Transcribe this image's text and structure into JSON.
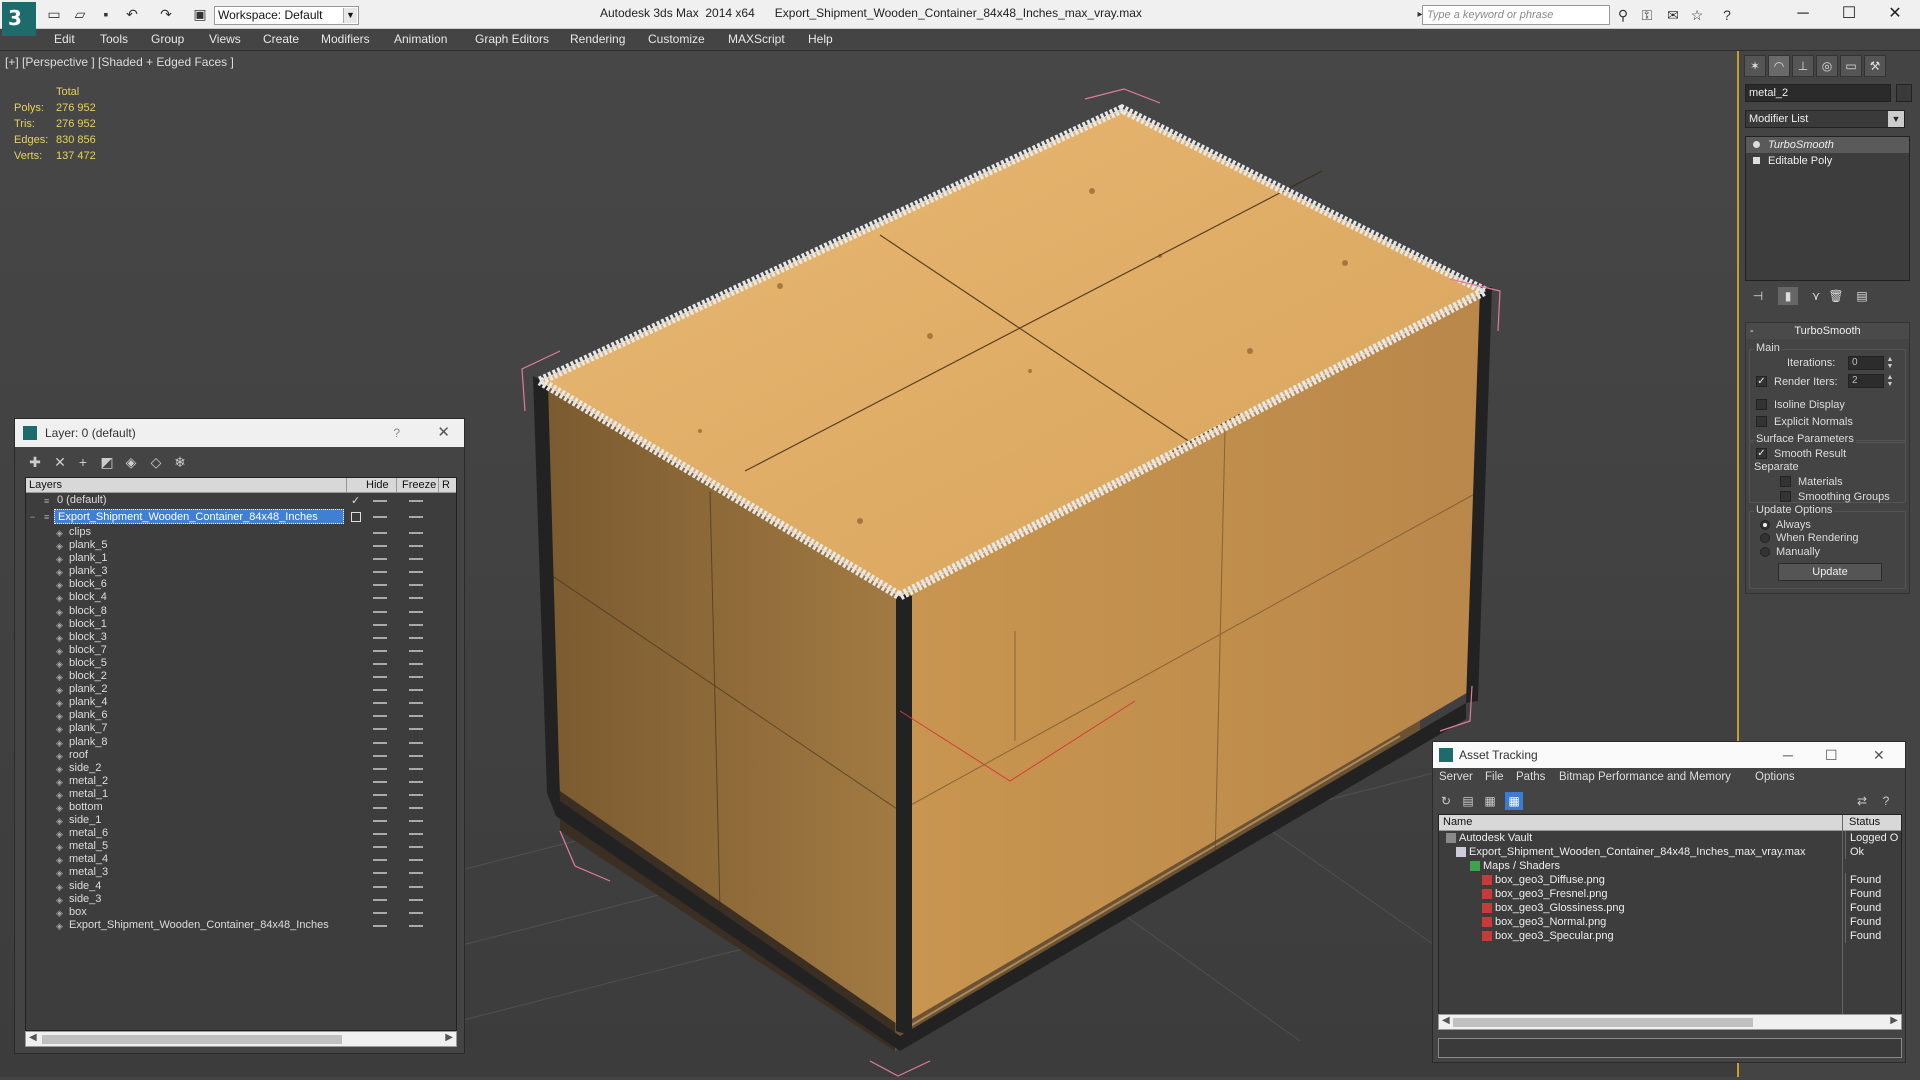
{
  "window": {
    "app_title": "Autodesk 3ds Max  2014 x64",
    "file_title": "Export_Shipment_Wooden_Container_84x48_Inches_max_vray.max",
    "workspace": "Workspace: Default",
    "search_placeholder": "Type a keyword or phrase"
  },
  "menu": [
    "Edit",
    "Tools",
    "Group",
    "Views",
    "Create",
    "Modifiers",
    "Animation",
    "Graph Editors",
    "Rendering",
    "Customize",
    "MAXScript",
    "Help"
  ],
  "viewport": {
    "label": "[+] [Perspective ] [Shaded + Edged Faces ]",
    "stats": {
      "header": "Total",
      "rows": [
        {
          "k": "Polys:",
          "v": "276 952"
        },
        {
          "k": "Tris:",
          "v": "276 952"
        },
        {
          "k": "Edges:",
          "v": "830 856"
        },
        {
          "k": "Verts:",
          "v": "137 472"
        }
      ]
    }
  },
  "command_panel": {
    "object_name": "metal_2",
    "modifier_list": "Modifier List",
    "stack": [
      "TurboSmooth",
      "Editable Poly"
    ],
    "rollout_title": "TurboSmooth",
    "main_label": "Main",
    "iterations_label": "Iterations:",
    "iterations_value": "0",
    "render_iters_label": "Render Iters:",
    "render_iters_value": "2",
    "isoline": "Isoline Display",
    "explicit_normals": "Explicit Normals",
    "surface_params": "Surface Parameters",
    "smooth_result": "Smooth Result",
    "separate": "Separate",
    "materials": "Materials",
    "smoothing_groups": "Smoothing Groups",
    "update_options": "Update Options",
    "always": "Always",
    "when_rendering": "When Rendering",
    "manually": "Manually",
    "update_button": "Update"
  },
  "layer_panel": {
    "title": "Layer: 0 (default)",
    "help": "?",
    "columns": {
      "layers": "Layers",
      "hide": "Hide",
      "freeze": "Freeze",
      "r": "R"
    },
    "default_layer": "0 (default)",
    "selected_layer": "Export_Shipment_Wooden_Container_84x48_Inches",
    "objects": [
      "clips",
      "plank_5",
      "plank_1",
      "plank_3",
      "block_6",
      "block_4",
      "block_8",
      "block_1",
      "block_3",
      "block_7",
      "block_5",
      "block_2",
      "plank_2",
      "plank_4",
      "plank_6",
      "plank_7",
      "plank_8",
      "roof",
      "side_2",
      "metal_2",
      "metal_1",
      "bottom",
      "side_1",
      "metal_6",
      "metal_5",
      "metal_4",
      "metal_3",
      "side_4",
      "side_3",
      "box",
      "Export_Shipment_Wooden_Container_84x48_Inches"
    ]
  },
  "asset_tracking": {
    "title": "Asset Tracking",
    "menu": [
      "Server",
      "File",
      "Paths",
      "Bitmap Performance and Memory",
      "Options"
    ],
    "columns": {
      "name": "Name",
      "status": "Status"
    },
    "rows": [
      {
        "name": "Autodesk Vault",
        "status": "Logged O"
      },
      {
        "name": "Export_Shipment_Wooden_Container_84x48_Inches_max_vray.max",
        "status": "Ok"
      },
      {
        "name": "Maps / Shaders",
        "status": ""
      },
      {
        "name": "box_geo3_Diffuse.png",
        "status": "Found"
      },
      {
        "name": "box_geo3_Fresnel.png",
        "status": "Found"
      },
      {
        "name": "box_geo3_Glossiness.png",
        "status": "Found"
      },
      {
        "name": "box_geo3_Normal.png",
        "status": "Found"
      },
      {
        "name": "box_geo3_Specular.png",
        "status": "Found"
      }
    ]
  },
  "colors": {
    "accent_selection": "#3f7fd5",
    "stats_text": "#e6d25a",
    "viewport_border": "#c8a028",
    "wood": "#d9a55a"
  }
}
